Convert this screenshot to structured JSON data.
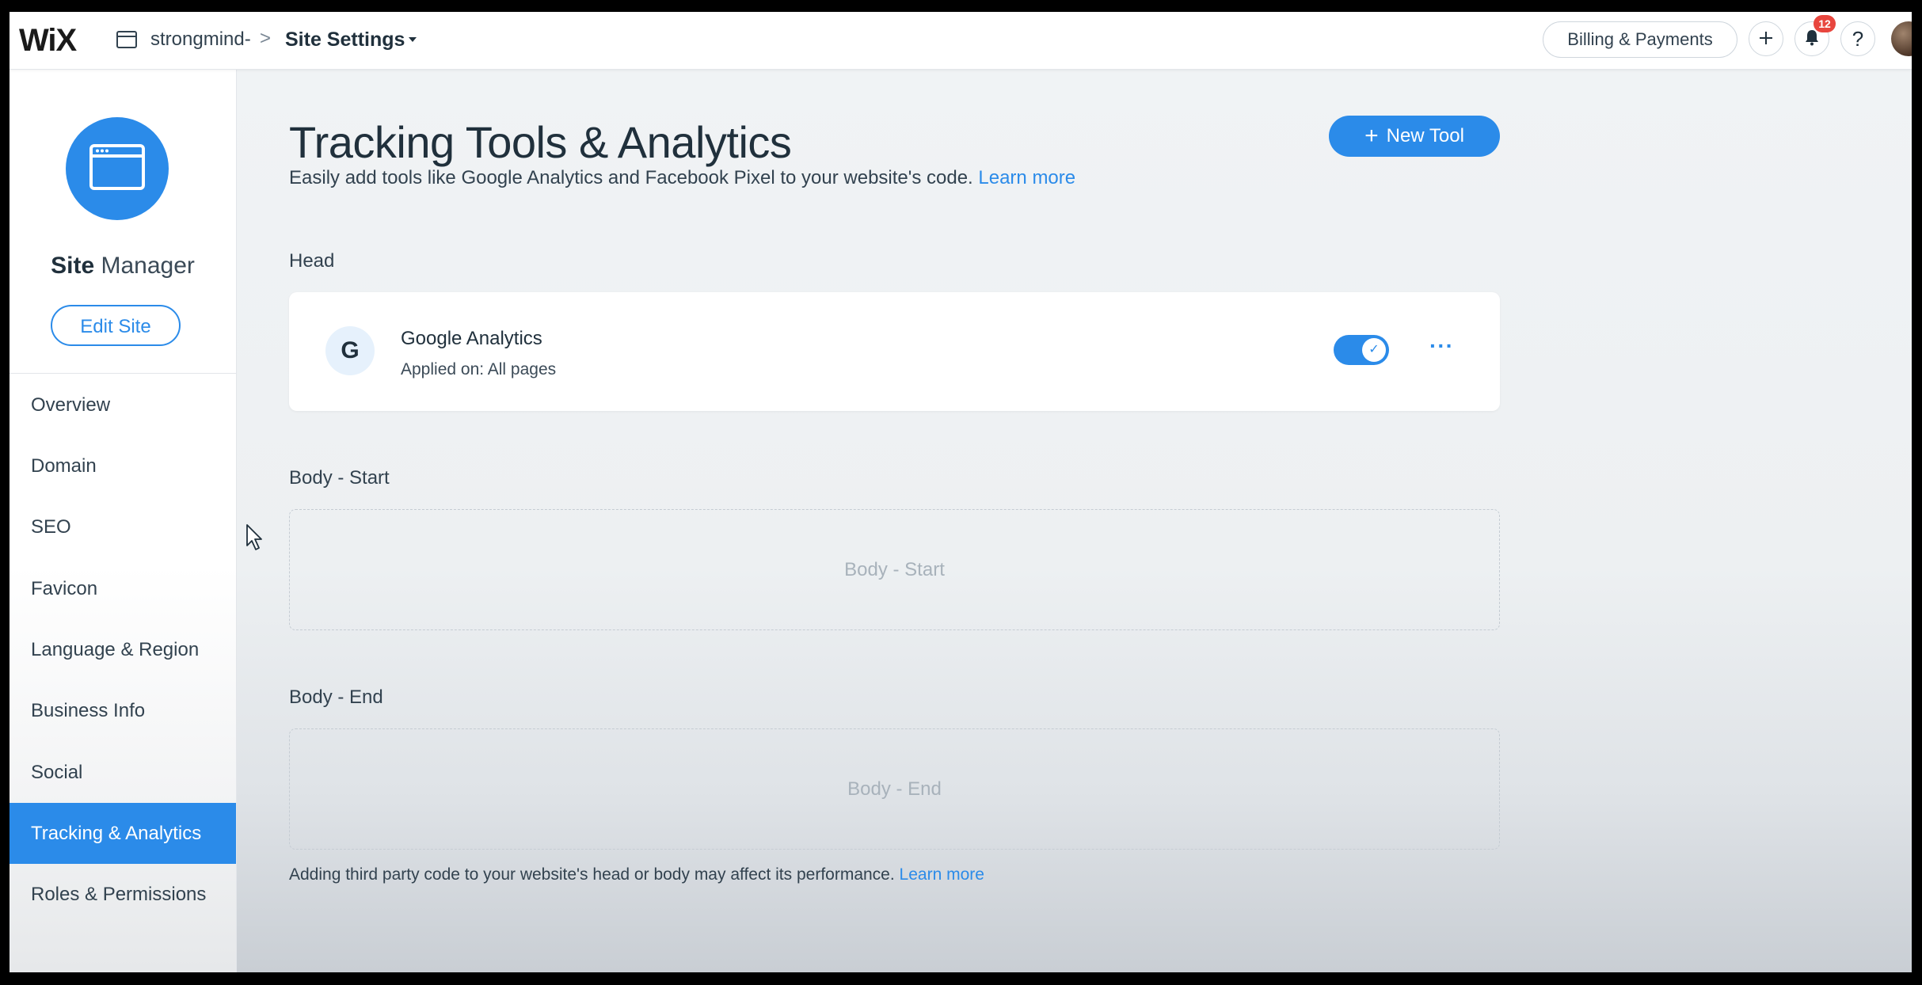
{
  "topbar": {
    "logo": "WiX",
    "site_name": "strongmind-",
    "separator": ">",
    "page": "Site Settings",
    "billing_label": "Billing & Payments",
    "notification_count": "12"
  },
  "sidebar": {
    "title_bold": "Site",
    "title_light": " Manager",
    "edit_label": "Edit Site",
    "items": [
      {
        "label": "Overview"
      },
      {
        "label": "Domain"
      },
      {
        "label": "SEO"
      },
      {
        "label": "Favicon"
      },
      {
        "label": "Language & Region"
      },
      {
        "label": "Business Info"
      },
      {
        "label": "Social"
      },
      {
        "label": "Tracking & Analytics"
      },
      {
        "label": "Roles & Permissions"
      }
    ],
    "active_index": 7
  },
  "main": {
    "title": "Tracking Tools & Analytics",
    "subtitle": "Easily add tools like Google Analytics and Facebook Pixel to your website's code.",
    "learn_more": "Learn more",
    "new_tool_label": "New Tool",
    "head_label": "Head",
    "tool": {
      "initial": "G",
      "name": "Google Analytics",
      "applied": "Applied on: All pages",
      "enabled": true,
      "more": "···"
    },
    "body_start_label": "Body - Start",
    "body_start_placeholder": "Body - Start",
    "body_end_label": "Body - End",
    "body_end_placeholder": "Body - End",
    "footer_note": "Adding third party code to your website's head or body may affect its performance.",
    "footer_learn_more": "Learn more"
  },
  "colors": {
    "accent": "#2b8be9",
    "badge": "#e8463e",
    "text": "#20303c"
  }
}
